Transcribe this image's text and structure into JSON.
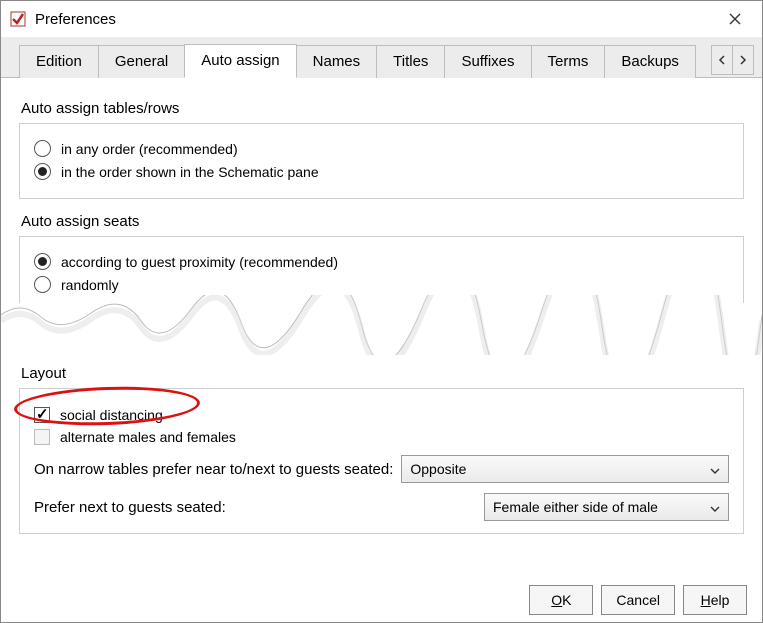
{
  "window": {
    "title": "Preferences"
  },
  "tabs": {
    "items": [
      {
        "label": "Edition"
      },
      {
        "label": "General"
      },
      {
        "label": "Auto assign"
      },
      {
        "label": "Names"
      },
      {
        "label": "Titles"
      },
      {
        "label": "Suffixes"
      },
      {
        "label": "Terms"
      },
      {
        "label": "Backups"
      }
    ],
    "active_index": 2
  },
  "section_tables": {
    "title": "Auto assign tables/rows",
    "options": [
      "in any order (recommended)",
      "in the order shown in the Schematic pane"
    ],
    "selected_index": 1
  },
  "section_seats": {
    "title": "Auto assign seats",
    "options": [
      "according to guest proximity (recommended)",
      "randomly"
    ],
    "selected_index": 0
  },
  "section_layout": {
    "title": "Layout",
    "social_distancing": {
      "label": "social distancing",
      "checked": true
    },
    "alternate": {
      "label": "alternate males and females",
      "checked": false,
      "disabled": true
    },
    "narrow": {
      "label": "On narrow tables prefer near to/next to guests seated:",
      "value": "Opposite"
    },
    "prefer_next": {
      "label": "Prefer next to guests seated:",
      "value": "Female either side of male"
    }
  },
  "buttons": {
    "ok": "OK",
    "cancel": "Cancel",
    "help": "Help"
  }
}
